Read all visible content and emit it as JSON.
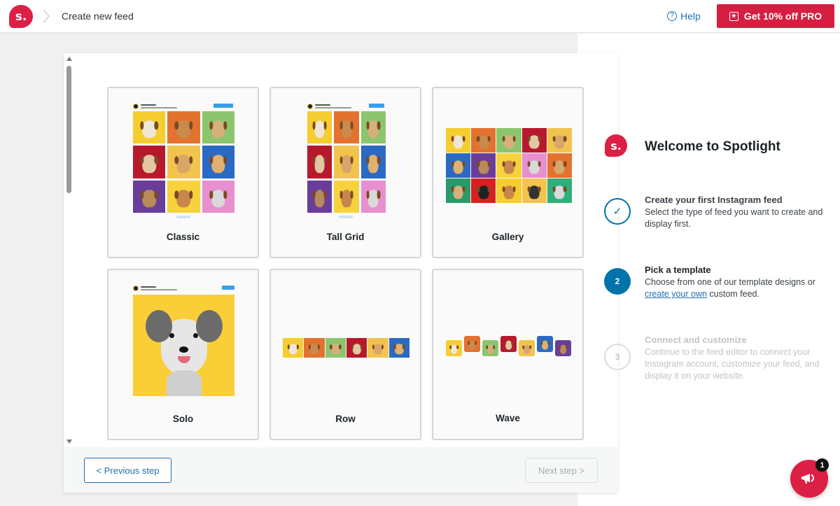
{
  "header": {
    "logo_text": "s.",
    "breadcrumb_title": "Create new feed",
    "help_label": "Help",
    "pro_label": "Get 10% off PRO"
  },
  "templates": [
    {
      "label": "Classic"
    },
    {
      "label": "Tall Grid"
    },
    {
      "label": "Gallery"
    },
    {
      "label": "Solo"
    },
    {
      "label": "Row"
    },
    {
      "label": "Wave"
    }
  ],
  "footer": {
    "prev_label": "< Previous step",
    "next_label": "Next step >"
  },
  "welcome": {
    "logo_text": "s.",
    "title": "Welcome to Spotlight"
  },
  "steps": [
    {
      "marker": "✓",
      "title": "Create your first Instagram feed",
      "desc": "Select the type of feed you want to create and display first.",
      "state": "done"
    },
    {
      "marker": "2",
      "title": "Pick a template",
      "desc_before": "Choose from one of our template designs or",
      "link": "create your own",
      "desc_after": "custom feed.",
      "state": "active"
    },
    {
      "marker": "3",
      "title": "Connect and customize",
      "desc": "Continue to the feed editor to connect your Instagram account, customize your feed, and display it on your website.",
      "state": "pending"
    }
  ],
  "notification_count": "1",
  "colors": {
    "brand_red": "#dc1f44",
    "accent_blue": "#0073aa",
    "tile_colors": [
      "#f5cd2e",
      "#e3722f",
      "#8cc56d",
      "#b8182c",
      "#f2c44e",
      "#2a6ac4",
      "#6a3d9a",
      "#f7d23c",
      "#e88fd0"
    ]
  }
}
